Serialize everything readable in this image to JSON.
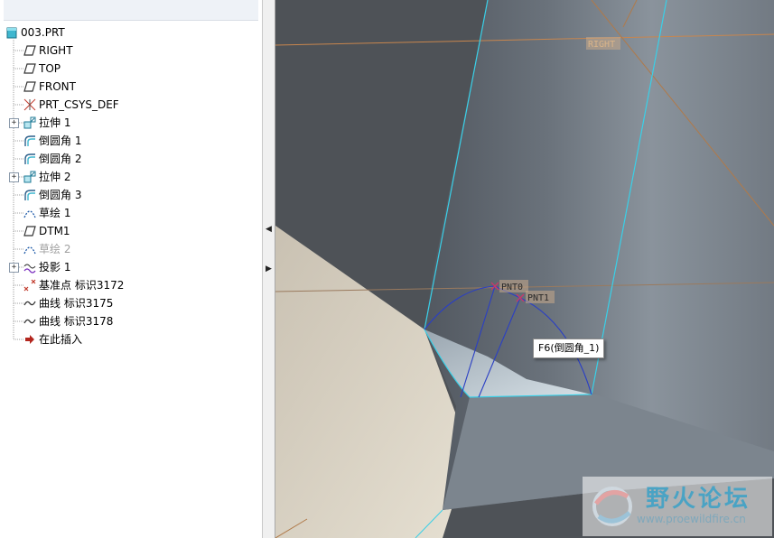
{
  "model_tree": {
    "root": {
      "label": "003.PRT",
      "icon": "part-icon"
    },
    "items": [
      {
        "label": "RIGHT",
        "icon": "datum-plane-icon",
        "expandable": false,
        "dim": false
      },
      {
        "label": "TOP",
        "icon": "datum-plane-icon",
        "expandable": false,
        "dim": false
      },
      {
        "label": "FRONT",
        "icon": "datum-plane-icon",
        "expandable": false,
        "dim": false
      },
      {
        "label": "PRT_CSYS_DEF",
        "icon": "coordinate-system-icon",
        "expandable": false,
        "dim": false
      },
      {
        "label": "拉伸 1",
        "icon": "extrude-icon",
        "expandable": true,
        "dim": false
      },
      {
        "label": "倒圆角 1",
        "icon": "round-icon",
        "expandable": false,
        "dim": false
      },
      {
        "label": "倒圆角 2",
        "icon": "round-icon",
        "expandable": false,
        "dim": false
      },
      {
        "label": "拉伸 2",
        "icon": "extrude-icon",
        "expandable": true,
        "dim": false
      },
      {
        "label": "倒圆角 3",
        "icon": "round-icon",
        "expandable": false,
        "dim": false
      },
      {
        "label": "草绘 1",
        "icon": "sketch-icon",
        "expandable": false,
        "dim": false
      },
      {
        "label": "DTM1",
        "icon": "datum-plane-icon",
        "expandable": false,
        "dim": false
      },
      {
        "label": "草绘 2",
        "icon": "sketch-icon",
        "expandable": false,
        "dim": true
      },
      {
        "label": "投影 1",
        "icon": "projection-icon",
        "expandable": true,
        "dim": false
      },
      {
        "label": "基准点 标识3172",
        "icon": "datum-point-icon",
        "expandable": false,
        "dim": false
      },
      {
        "label": "曲线 标识3175",
        "icon": "curve-icon",
        "expandable": false,
        "dim": false
      },
      {
        "label": "曲线 标识3178",
        "icon": "curve-icon",
        "expandable": false,
        "dim": false
      },
      {
        "label": "在此插入",
        "icon": "insert-here-arrow-icon",
        "expandable": false,
        "dim": false
      }
    ]
  },
  "viewport": {
    "labels": {
      "right_plane": "RIGHT",
      "point_0": "PNT0",
      "point_1": "PNT1"
    },
    "tooltip": "F6(倒圆角_1)",
    "colors": {
      "background": "#4e5257",
      "datum": "#c8864e",
      "edge_highlight": "#39d0e8",
      "curve": "#2a3fc4",
      "floor": "#ddd6c6"
    }
  },
  "watermark": {
    "title": "野火论坛",
    "url": "www.proewildfire.cn"
  }
}
